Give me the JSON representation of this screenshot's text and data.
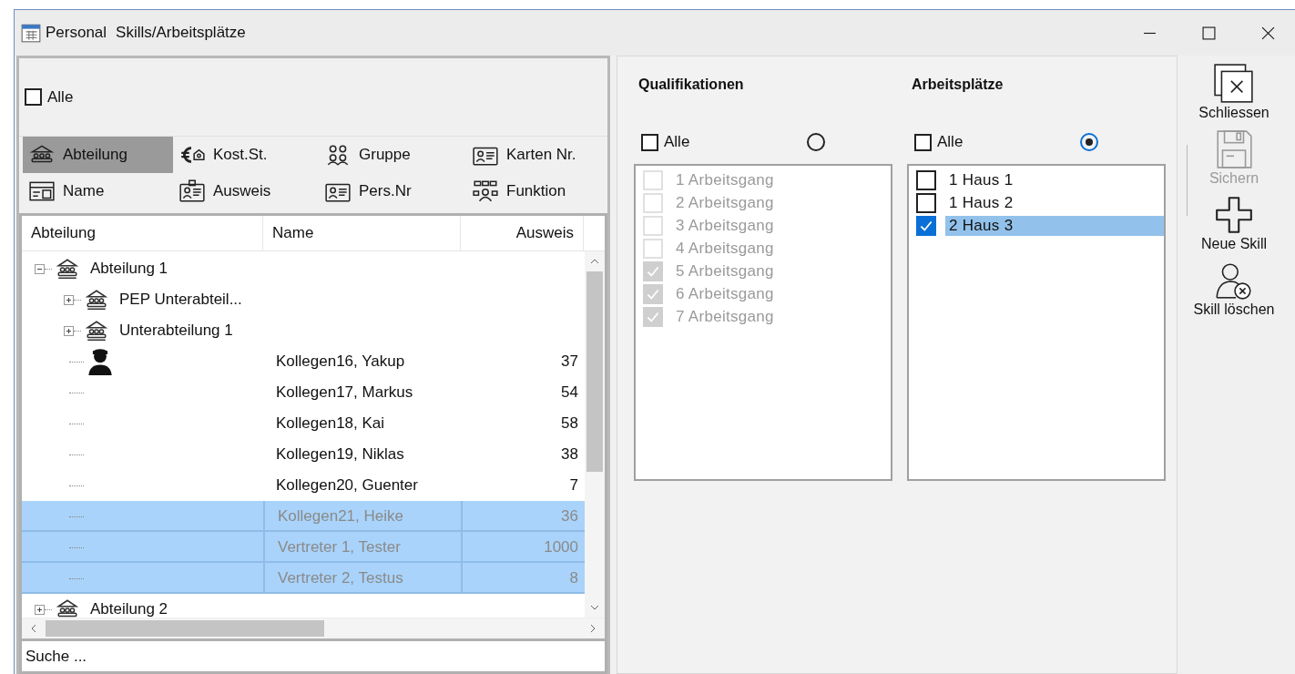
{
  "window": {
    "app": "Personal",
    "title": "Skills/Arbeitsplätze"
  },
  "filter": {
    "all": {
      "label": "Alle",
      "checked": false
    },
    "buttons": [
      {
        "label": "Abteilung",
        "selected": true
      },
      {
        "label": "Kost.St.",
        "selected": false
      },
      {
        "label": "Gruppe",
        "selected": false
      },
      {
        "label": "Karten Nr.",
        "selected": false
      },
      {
        "label": "Name",
        "selected": false
      },
      {
        "label": "Ausweis",
        "selected": false
      },
      {
        "label": "Pers.Nr",
        "selected": false
      },
      {
        "label": "Funktion",
        "selected": false
      }
    ]
  },
  "tree": {
    "columns": [
      "Abteilung",
      "Name",
      "Ausweis"
    ],
    "rows": [
      {
        "kind": "department",
        "label": "Abteilung 1",
        "expanded": true,
        "children": [
          {
            "kind": "department",
            "label": "PEP Unterabteil...",
            "expanded": false
          },
          {
            "kind": "department",
            "label": "Unterabteilung 1",
            "expanded": false
          },
          {
            "kind": "person",
            "avatar": true,
            "name": "Kollegen16, Yakup",
            "id": "37",
            "selected": false
          },
          {
            "kind": "person",
            "avatar": false,
            "name": "Kollegen17, Markus",
            "id": "54",
            "selected": false
          },
          {
            "kind": "person",
            "avatar": false,
            "name": "Kollegen18, Kai",
            "id": "58",
            "selected": false
          },
          {
            "kind": "person",
            "avatar": false,
            "name": "Kollegen19, Niklas",
            "id": "38",
            "selected": false
          },
          {
            "kind": "person",
            "avatar": false,
            "name": "Kollegen20, Guenter",
            "id": "7",
            "selected": false
          },
          {
            "kind": "person",
            "avatar": false,
            "name": "Kollegen21, Heike",
            "id": "36",
            "selected": true
          },
          {
            "kind": "person",
            "avatar": false,
            "name": "Vertreter 1, Tester",
            "id": "1000",
            "selected": true
          },
          {
            "kind": "person",
            "avatar": false,
            "name": "Vertreter 2, Testus",
            "id": "8",
            "selected": true
          }
        ]
      },
      {
        "kind": "department",
        "label": "Abteilung 2",
        "expanded": false
      }
    ]
  },
  "search": {
    "placeholder": "Suche ..."
  },
  "lists": [
    {
      "title": "Qualifikationen",
      "all": {
        "label": "Alle",
        "checked": false
      },
      "radio_selected": false,
      "items": [
        {
          "label": "1 Arbeitsgang",
          "checked": false,
          "disabled": true,
          "selected": false
        },
        {
          "label": "2 Arbeitsgang",
          "checked": false,
          "disabled": true,
          "selected": false
        },
        {
          "label": "3 Arbeitsgang",
          "checked": false,
          "disabled": true,
          "selected": false
        },
        {
          "label": "4 Arbeitsgang",
          "checked": false,
          "disabled": true,
          "selected": false
        },
        {
          "label": "5 Arbeitsgang",
          "checked": true,
          "disabled": true,
          "selected": false
        },
        {
          "label": "6 Arbeitsgang",
          "checked": true,
          "disabled": true,
          "selected": false
        },
        {
          "label": "7 Arbeitsgang",
          "checked": true,
          "disabled": true,
          "selected": false
        }
      ]
    },
    {
      "title": "Arbeitsplätze",
      "all": {
        "label": "Alle",
        "checked": false
      },
      "radio_selected": true,
      "items": [
        {
          "label": "1 Haus 1",
          "checked": false,
          "disabled": false,
          "selected": false
        },
        {
          "label": "1 Haus 2",
          "checked": false,
          "disabled": false,
          "selected": false
        },
        {
          "label": "2 Haus 3",
          "checked": true,
          "disabled": false,
          "selected": true
        }
      ]
    }
  ],
  "toolbar": [
    {
      "kind": "close",
      "label": "Schliessen",
      "disabled": false
    },
    {
      "kind": "save",
      "label": "Sichern",
      "disabled": true
    },
    {
      "kind": "add",
      "label": "Neue Skill",
      "disabled": false
    },
    {
      "kind": "delete",
      "label": "Skill löschen",
      "disabled": false
    }
  ]
}
